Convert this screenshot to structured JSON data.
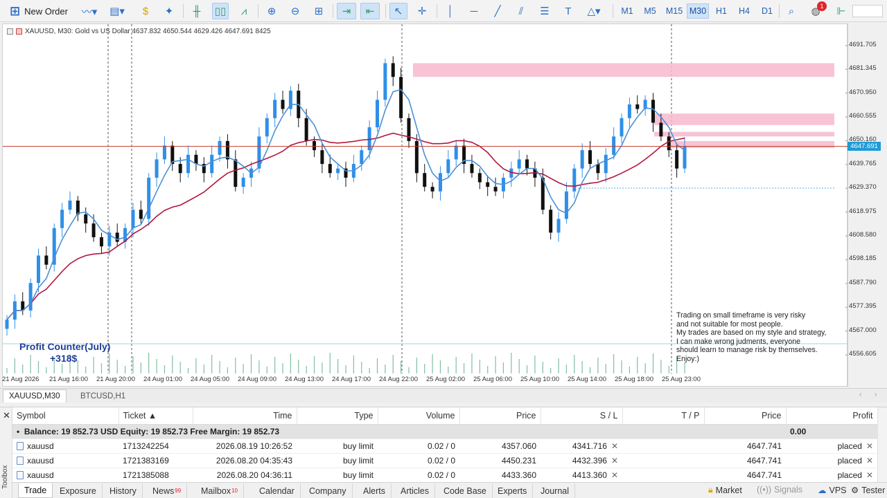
{
  "toolbar": {
    "new_order": "New Order",
    "timeframes": [
      "M1",
      "M5",
      "M15",
      "M30",
      "H1",
      "H4",
      "D1"
    ],
    "active_timeframe": "M30",
    "notification_count": "1"
  },
  "chart": {
    "info_line": "XAUUSD, M30:  Gold vs US Dollar  4637.832 4650.544 4629.426 4647.691  8425",
    "current_price": "4647.691",
    "profit_counter_title": "Profit Counter(July)",
    "profit_counter_value": "+318$",
    "note_lines": [
      "Trading on small timeframe is very risky",
      "and not suitable for most people.",
      "My trades are based on my style and strategy,",
      "I can make wrong judments, everyone",
      "should learn to manage risk by themselves.",
      "Enjoy:)"
    ],
    "colors": {
      "bull": "#2f8fe8",
      "bear": "#111111",
      "ma_fast": "#4a90d9",
      "ma_slow": "#b0163c",
      "zone": "#f7b9cc",
      "price_line": "#c0392b",
      "volume": "#7fbfa0"
    }
  },
  "chart_data": {
    "type": "candlestick",
    "symbol": "XAUUSD",
    "timeframe": "M30",
    "ohlc_last": {
      "open": 4637.832,
      "high": 4650.544,
      "low": 4629.426,
      "close": 4647.691
    },
    "ylim": [
      4550,
      4698
    ],
    "y_ticks": [
      "4691.705",
      "4681.345",
      "4670.950",
      "4660.555",
      "4650.160",
      "4639.765",
      "4629.370",
      "4618.975",
      "4608.580",
      "4598.185",
      "4587.790",
      "4577.395",
      "4567.000",
      "4556.605"
    ],
    "x_ticks": [
      "21 Aug 2026",
      "21 Aug 16:00",
      "21 Aug 20:00",
      "24 Aug 01:00",
      "24 Aug 05:00",
      "24 Aug 09:00",
      "24 Aug 13:00",
      "24 Aug 17:00",
      "24 Aug 22:00",
      "25 Aug 02:00",
      "25 Aug 06:00",
      "25 Aug 10:00",
      "25 Aug 14:00",
      "25 Aug 18:00",
      "25 Aug 23:00"
    ],
    "closes": [
      4572,
      4580,
      4576,
      4588,
      4600,
      4596,
      4612,
      4620,
      4624,
      4618,
      4614,
      4608,
      4604,
      4610,
      4606,
      4612,
      4620,
      4616,
      4634,
      4642,
      4648,
      4640,
      4636,
      4644,
      4640,
      4636,
      4644,
      4650,
      4642,
      4630,
      4634,
      4638,
      4652,
      4660,
      4668,
      4664,
      4672,
      4660,
      4650,
      4646,
      4640,
      4636,
      4638,
      4634,
      4640,
      4646,
      4656,
      4668,
      4684,
      4678,
      4660,
      4650,
      4636,
      4630,
      4628,
      4636,
      4642,
      4648,
      4640,
      4636,
      4632,
      4630,
      4628,
      4634,
      4638,
      4642,
      4638,
      4634,
      4620,
      4610,
      4616,
      4628,
      4638,
      4646,
      4640,
      4636,
      4644,
      4652,
      4660,
      4666,
      4664,
      4668,
      4658,
      4652,
      4646,
      4638,
      4647.691
    ],
    "zones": [
      [
        4678,
        4684
      ],
      [
        4657,
        4662
      ],
      [
        4652,
        4654
      ],
      [
        4647,
        4650
      ]
    ]
  },
  "chart_tabs": [
    "XAUUSD,M30",
    "BTCUSD,H1"
  ],
  "terminal": {
    "columns": [
      "Symbol",
      "Ticket",
      "Time",
      "Type",
      "Volume",
      "Price",
      "S / L",
      "T / P",
      "Price",
      "Profit"
    ],
    "balance_line": "Balance: 19 852.73 USD  Equity: 19 852.73  Free Margin: 19 852.73",
    "balance_profit": "0.00",
    "rows": [
      {
        "symbol": "xauusd",
        "ticket": "1713242254",
        "time": "2026.08.19 10:26:52",
        "type": "buy limit",
        "volume": "0.02 / 0",
        "price": "4357.060",
        "sl": "4341.716",
        "tp": "",
        "cur_price": "4647.741",
        "profit": "placed"
      },
      {
        "symbol": "xauusd",
        "ticket": "1721383169",
        "time": "2026.08.20 04:35:43",
        "type": "buy limit",
        "volume": "0.02 / 0",
        "price": "4450.231",
        "sl": "4432.396",
        "tp": "",
        "cur_price": "4647.741",
        "profit": "placed"
      },
      {
        "symbol": "xauusd",
        "ticket": "1721385088",
        "time": "2026.08.20 04:36:11",
        "type": "buy limit",
        "volume": "0.02 / 0",
        "price": "4433.360",
        "sl": "4413.360",
        "tp": "",
        "cur_price": "4647.741",
        "profit": "placed"
      }
    ],
    "toolbox_label": "Toolbox"
  },
  "bottom_tabs": [
    {
      "label": "Trade",
      "badge": ""
    },
    {
      "label": "Exposure",
      "badge": ""
    },
    {
      "label": "History",
      "badge": ""
    },
    {
      "label": "News",
      "badge": "99"
    },
    {
      "label": "Mailbox",
      "badge": "10"
    },
    {
      "label": "Calendar",
      "badge": ""
    },
    {
      "label": "Company",
      "badge": ""
    },
    {
      "label": "Alerts",
      "badge": ""
    },
    {
      "label": "Articles",
      "badge": ""
    },
    {
      "label": "Code Base",
      "badge": ""
    },
    {
      "label": "Experts",
      "badge": ""
    },
    {
      "label": "Journal",
      "badge": ""
    }
  ],
  "right_tabs": {
    "market": "Market",
    "signals": "Signals",
    "vps": "VPS",
    "tester": "Tester"
  }
}
